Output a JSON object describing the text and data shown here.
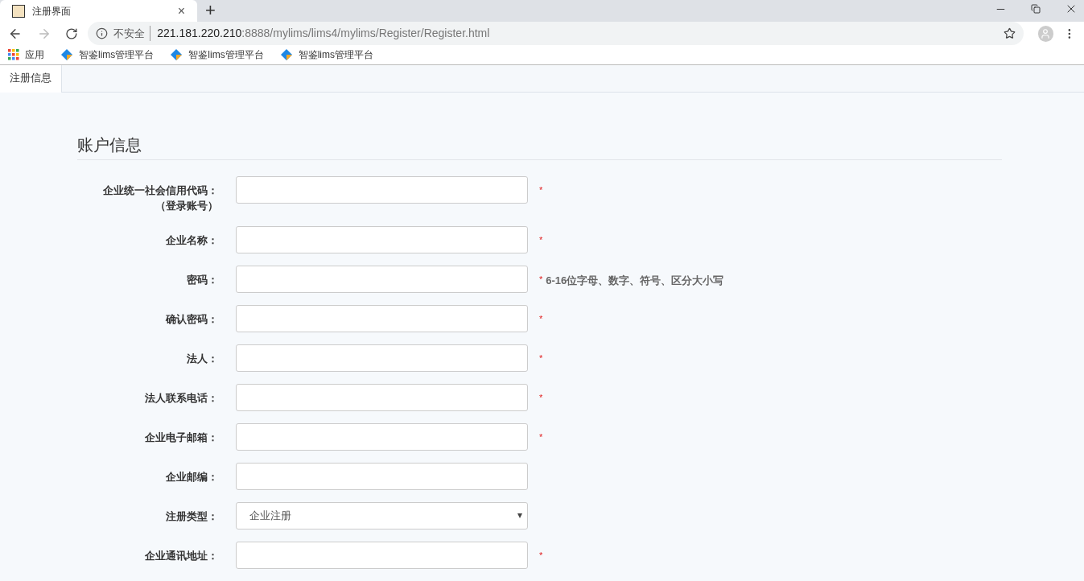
{
  "browser": {
    "tab_title": "注册界面",
    "tab_close": "×",
    "new_tab": "+",
    "security": "不安全",
    "url_host": "221.181.220.210",
    "url_path": ":8888/mylims/lims4/mylims/Register/Register.html",
    "bookmarks": [
      {
        "kind": "apps",
        "label": "应用"
      },
      {
        "kind": "site",
        "label": "智鉴lims管理平台"
      },
      {
        "kind": "site",
        "label": "智鉴lims管理平台"
      },
      {
        "kind": "site",
        "label": "智鉴lims管理平台"
      }
    ]
  },
  "page_tabs": [
    {
      "label": "注册信息",
      "selected": true
    }
  ],
  "section_title": "账户信息",
  "fields": [
    {
      "kind": "input",
      "label": "企业统一社会信用代码：",
      "sublabel": "（登录账号）",
      "mark": "*"
    },
    {
      "kind": "input",
      "label": "企业名称：",
      "mark": "*"
    },
    {
      "kind": "input",
      "label": "密码：",
      "mark": "*",
      "hint": "6-16位字母、数字、符号、区分大小写"
    },
    {
      "kind": "input",
      "label": "确认密码：",
      "mark": "*"
    },
    {
      "kind": "input",
      "label": "法人：",
      "mark": "*"
    },
    {
      "kind": "input",
      "label": "法人联系电话：",
      "mark": "*"
    },
    {
      "kind": "input",
      "label": "企业电子邮箱：",
      "mark": "*"
    },
    {
      "kind": "input",
      "label": "企业邮编："
    },
    {
      "kind": "select",
      "label": "注册类型：",
      "value": "企业注册"
    },
    {
      "kind": "input",
      "label": "企业通讯地址：",
      "mark": "*"
    }
  ]
}
